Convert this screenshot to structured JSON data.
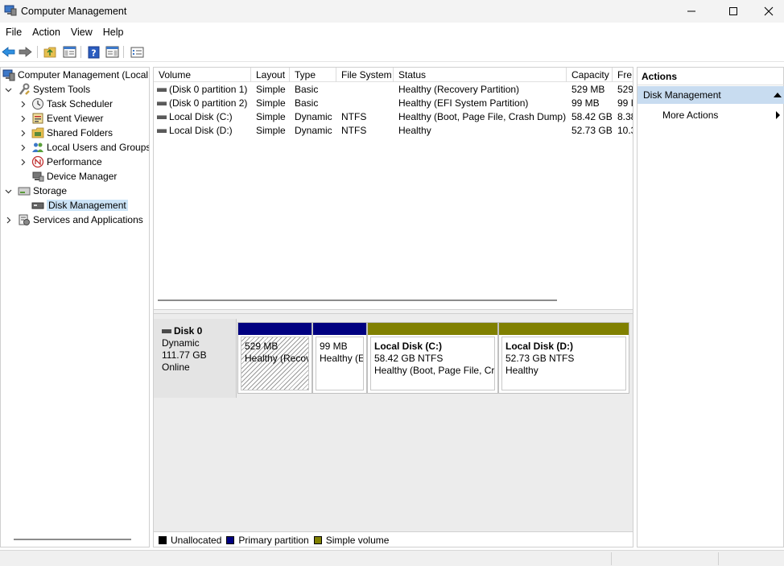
{
  "window": {
    "title": "Computer Management"
  },
  "menu": [
    "File",
    "Action",
    "View",
    "Help"
  ],
  "tree": {
    "root": "Computer Management (Local",
    "items": [
      {
        "label": "System Tools",
        "level": 1,
        "expander": "expanded",
        "icon": "tools-icon"
      },
      {
        "label": "Task Scheduler",
        "level": 2,
        "expander": "collapsed",
        "icon": "clock-icon"
      },
      {
        "label": "Event Viewer",
        "level": 2,
        "expander": "collapsed",
        "icon": "event-viewer-icon"
      },
      {
        "label": "Shared Folders",
        "level": 2,
        "expander": "collapsed",
        "icon": "shared-folder-icon"
      },
      {
        "label": "Local Users and Groups",
        "level": 2,
        "expander": "collapsed",
        "icon": "users-icon"
      },
      {
        "label": "Performance",
        "level": 2,
        "expander": "collapsed",
        "icon": "performance-icon"
      },
      {
        "label": "Device Manager",
        "level": 2,
        "expander": "none",
        "icon": "device-manager-icon"
      },
      {
        "label": "Storage",
        "level": 1,
        "expander": "expanded",
        "icon": "storage-icon"
      },
      {
        "label": "Disk Management",
        "level": 2,
        "expander": "none",
        "icon": "disk-management-icon",
        "selected": true
      },
      {
        "label": "Services and Applications",
        "level": 1,
        "expander": "collapsed",
        "icon": "services-icon"
      }
    ]
  },
  "volumes": {
    "columns": [
      "Volume",
      "Layout",
      "Type",
      "File System",
      "Status",
      "Capacity",
      "Fre"
    ],
    "rows": [
      [
        "(Disk 0 partition 1)",
        "Simple",
        "Basic",
        "",
        "Healthy (Recovery Partition)",
        "529 MB",
        "529"
      ],
      [
        "(Disk 0 partition 2)",
        "Simple",
        "Basic",
        "",
        "Healthy (EFI System Partition)",
        "99 MB",
        "99 I"
      ],
      [
        "Local Disk (C:)",
        "Simple",
        "Dynamic",
        "NTFS",
        "Healthy (Boot, Page File, Crash Dump)",
        "58.42 GB",
        "8.38"
      ],
      [
        "Local Disk (D:)",
        "Simple",
        "Dynamic",
        "NTFS",
        "Healthy",
        "52.73 GB",
        "10.3"
      ]
    ]
  },
  "disk": {
    "name": "Disk 0",
    "type": "Dynamic",
    "size": "111.77 GB",
    "state": "Online",
    "partitions": [
      {
        "name": "",
        "line1": "529 MB",
        "line2": "Healthy (Recov",
        "color": "#000080",
        "hatched": true
      },
      {
        "name": "",
        "line1": "99 MB",
        "line2": "Healthy (E",
        "color": "#000080",
        "hatched": false
      },
      {
        "name": "Local Disk  (C:)",
        "line1": "58.42 GB NTFS",
        "line2": "Healthy (Boot, Page File, Cra",
        "color": "#808000",
        "hatched": false
      },
      {
        "name": "Local Disk  (D:)",
        "line1": "52.73 GB NTFS",
        "line2": "Healthy",
        "color": "#808000",
        "hatched": false
      }
    ]
  },
  "legend": [
    {
      "label": "Unallocated",
      "color": "#000000"
    },
    {
      "label": "Primary partition",
      "color": "#000080"
    },
    {
      "label": "Simple volume",
      "color": "#808000"
    }
  ],
  "actions": {
    "header": "Actions",
    "section": "Disk Management",
    "item": "More Actions"
  }
}
